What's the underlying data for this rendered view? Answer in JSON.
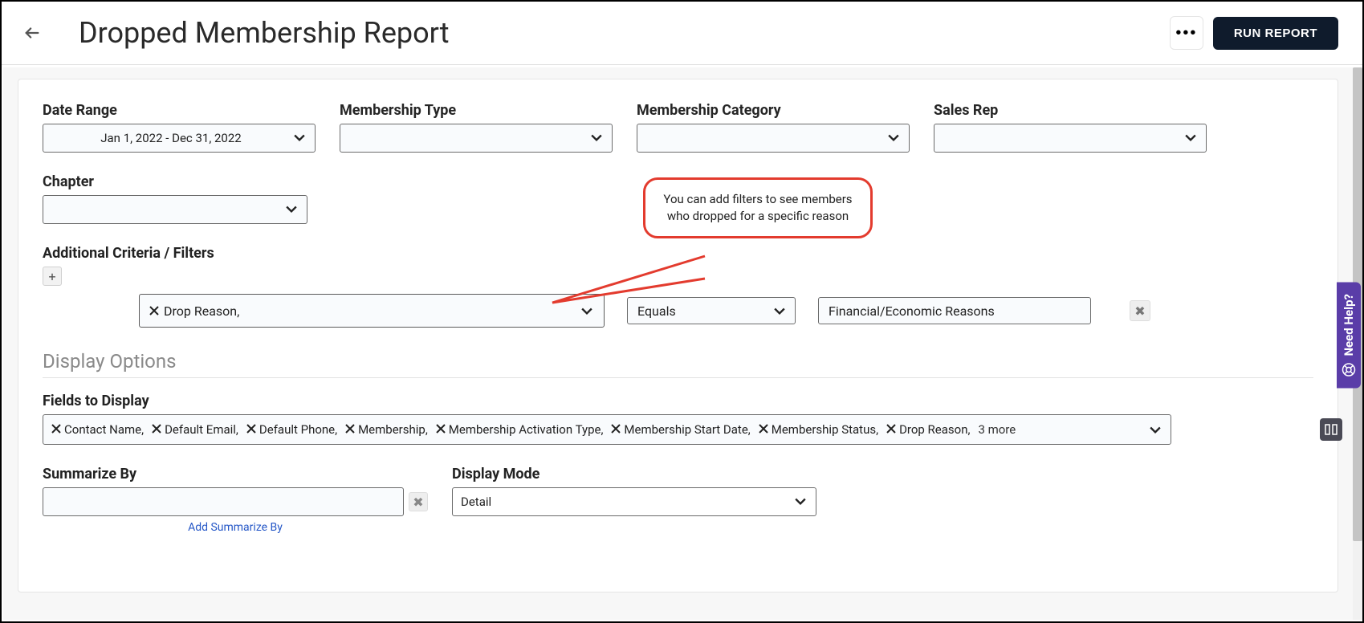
{
  "header": {
    "title": "Dropped Membership Report",
    "run_label": "RUN REPORT"
  },
  "filters": {
    "date_range": {
      "label": "Date Range",
      "value": "Jan 1, 2022 - Dec 31, 2022"
    },
    "membership_type": {
      "label": "Membership Type",
      "value": ""
    },
    "membership_category": {
      "label": "Membership Category",
      "value": ""
    },
    "sales_rep": {
      "label": "Sales Rep",
      "value": ""
    },
    "chapter": {
      "label": "Chapter",
      "value": ""
    }
  },
  "additional_criteria": {
    "label": "Additional Criteria / Filters",
    "rows": [
      {
        "field": "Drop Reason,",
        "operator": "Equals",
        "value": "Financial/Economic Reasons"
      }
    ]
  },
  "display_options": {
    "title": "Display Options",
    "fields_label": "Fields to Display",
    "fields": [
      "Contact Name,",
      "Default Email,",
      "Default Phone,",
      "Membership,",
      "Membership Activation Type,",
      "Membership Start Date,",
      "Membership Status,",
      "Drop Reason,"
    ],
    "fields_more": "3 more",
    "summarize_label": "Summarize By",
    "summarize_value": "",
    "add_summarize": "Add Summarize By",
    "display_mode_label": "Display Mode",
    "display_mode_value": "Detail"
  },
  "callout": {
    "text": "You can add filters to see members who dropped for a specific reason"
  },
  "help_tab": "Need Help?"
}
